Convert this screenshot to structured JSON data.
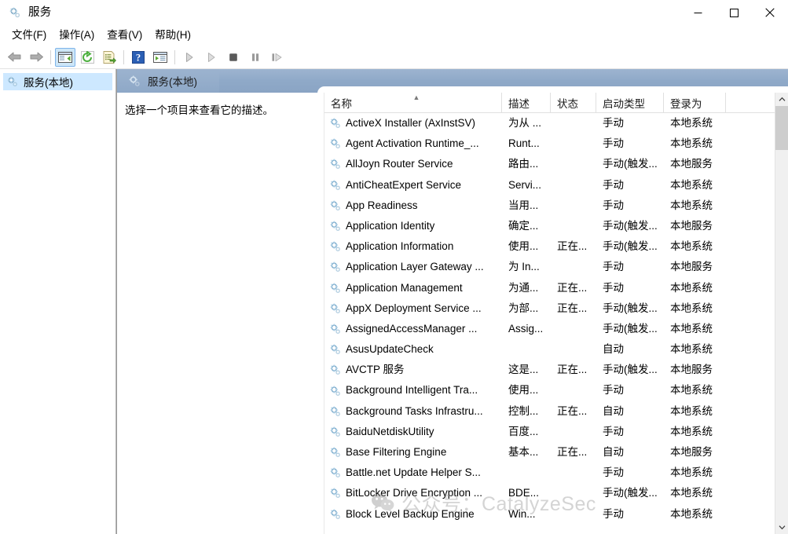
{
  "window": {
    "title": "服务",
    "icon": "services-gear-icon",
    "controls": {
      "minimize": "minimize-icon",
      "maximize": "maximize-icon",
      "close": "close-icon"
    }
  },
  "menubar": {
    "items": [
      {
        "label": "文件(F)",
        "name": "menu-file"
      },
      {
        "label": "操作(A)",
        "name": "menu-action"
      },
      {
        "label": "查看(V)",
        "name": "menu-view"
      },
      {
        "label": "帮助(H)",
        "name": "menu-help"
      }
    ]
  },
  "toolbar": {
    "buttons": [
      {
        "name": "back-arrow-icon",
        "type": "arrow-left",
        "enabled": false
      },
      {
        "name": "forward-arrow-icon",
        "type": "arrow-right",
        "enabled": false
      },
      {
        "name": "show-hide-tree-icon",
        "type": "pane",
        "active": true
      },
      {
        "name": "refresh-icon",
        "type": "refresh"
      },
      {
        "name": "export-list-icon",
        "type": "export"
      },
      {
        "name": "help-icon",
        "type": "help"
      },
      {
        "name": "properties-icon",
        "type": "properties"
      },
      {
        "name": "start-service-icon",
        "type": "play"
      },
      {
        "name": "resume-service-icon",
        "type": "play2"
      },
      {
        "name": "stop-service-icon",
        "type": "stop"
      },
      {
        "name": "pause-service-icon",
        "type": "pause"
      },
      {
        "name": "restart-service-icon",
        "type": "restart"
      }
    ]
  },
  "tree": {
    "root": {
      "label": "服务(本地)",
      "icon": "services-gear-icon",
      "selected": true
    }
  },
  "mmc_header": {
    "title": "服务(本地)",
    "icon": "services-gear-icon"
  },
  "description_pane": {
    "text": "选择一个项目来查看它的描述。"
  },
  "listview": {
    "columns": [
      {
        "label": "名称",
        "name": "column-name",
        "sorted": "asc"
      },
      {
        "label": "描述",
        "name": "column-description"
      },
      {
        "label": "状态",
        "name": "column-status"
      },
      {
        "label": "启动类型",
        "name": "column-startup-type"
      },
      {
        "label": "登录为",
        "name": "column-log-on-as"
      }
    ],
    "rows": [
      {
        "name": "ActiveX Installer (AxInstSV)",
        "description": "为从 ...",
        "status": "",
        "startup": "手动",
        "logon": "本地系统"
      },
      {
        "name": "Agent Activation Runtime_...",
        "description": "Runt...",
        "status": "",
        "startup": "手动",
        "logon": "本地系统"
      },
      {
        "name": "AllJoyn Router Service",
        "description": "路由...",
        "status": "",
        "startup": "手动(触发...",
        "logon": "本地服务"
      },
      {
        "name": "AntiCheatExpert Service",
        "description": "Servi...",
        "status": "",
        "startup": "手动",
        "logon": "本地系统"
      },
      {
        "name": "App Readiness",
        "description": "当用...",
        "status": "",
        "startup": "手动",
        "logon": "本地系统"
      },
      {
        "name": "Application Identity",
        "description": "确定...",
        "status": "",
        "startup": "手动(触发...",
        "logon": "本地服务"
      },
      {
        "name": "Application Information",
        "description": "使用...",
        "status": "正在...",
        "startup": "手动(触发...",
        "logon": "本地系统"
      },
      {
        "name": "Application Layer Gateway ...",
        "description": "为 In...",
        "status": "",
        "startup": "手动",
        "logon": "本地服务"
      },
      {
        "name": "Application Management",
        "description": "为通...",
        "status": "正在...",
        "startup": "手动",
        "logon": "本地系统"
      },
      {
        "name": "AppX Deployment Service ...",
        "description": "为部...",
        "status": "正在...",
        "startup": "手动(触发...",
        "logon": "本地系统"
      },
      {
        "name": "AssignedAccessManager ...",
        "description": "Assig...",
        "status": "",
        "startup": "手动(触发...",
        "logon": "本地系统"
      },
      {
        "name": "AsusUpdateCheck",
        "description": "",
        "status": "",
        "startup": "自动",
        "logon": "本地系统"
      },
      {
        "name": "AVCTP 服务",
        "description": "这是...",
        "status": "正在...",
        "startup": "手动(触发...",
        "logon": "本地服务"
      },
      {
        "name": "Background Intelligent Tra...",
        "description": "使用...",
        "status": "",
        "startup": "手动",
        "logon": "本地系统"
      },
      {
        "name": "Background Tasks Infrastru...",
        "description": "控制...",
        "status": "正在...",
        "startup": "自动",
        "logon": "本地系统"
      },
      {
        "name": "BaiduNetdiskUtility",
        "description": "百度...",
        "status": "",
        "startup": "手动",
        "logon": "本地系统"
      },
      {
        "name": "Base Filtering Engine",
        "description": "基本...",
        "status": "正在...",
        "startup": "自动",
        "logon": "本地服务"
      },
      {
        "name": "Battle.net Update Helper S...",
        "description": "",
        "status": "",
        "startup": "手动",
        "logon": "本地系统"
      },
      {
        "name": "BitLocker Drive Encryption ...",
        "description": "BDE...",
        "status": "",
        "startup": "手动(触发...",
        "logon": "本地系统"
      },
      {
        "name": "Block Level Backup Engine",
        "description": "Win...",
        "status": "",
        "startup": "手动",
        "logon": "本地系统"
      }
    ]
  },
  "scrollbar": {
    "up_arrow": "scroll-up-icon",
    "down_arrow": "scroll-down-icon",
    "thumb": "scroll-thumb"
  },
  "watermark": {
    "text": "公众号：CatalyzeSec",
    "logo": "wechat-icon"
  },
  "colors": {
    "header_blue": "#8fa9c8",
    "selection_blue": "#cde8ff",
    "toolbar_active": "#cde6f7",
    "gear_blue": "#8fc4e3",
    "scroll_thumb": "#cdcdcd"
  }
}
